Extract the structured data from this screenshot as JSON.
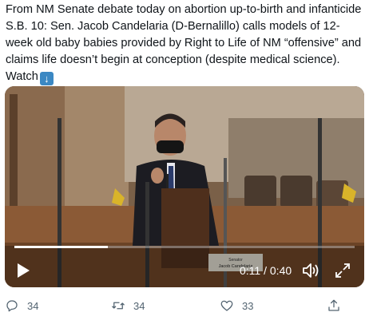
{
  "tweet": {
    "text": "From NM Senate debate today on abortion up-to-birth and infanticide S.B. 10: Sen. Jacob Candelaria (D-Bernalillo) calls models of 12-week old baby babies provided by Right to Life of NM “offensive” and claims life doesn’t begin at conception (despite medical science). Watch",
    "emoji": "arrow-down-emoji"
  },
  "video": {
    "current_time": "0:11",
    "separator": " / ",
    "duration": "0:40",
    "progress_fraction": 0.275,
    "nameplate_line1": "Senator",
    "nameplate_line2": "Jacob Candelaria",
    "play_icon": "play-icon",
    "volume_icon": "volume-icon",
    "fullscreen_icon": "fullscreen-icon"
  },
  "actions": {
    "reply_count": "34",
    "retweet_count": "34",
    "like_count": "33"
  },
  "colors": {
    "text": "#0f1419",
    "muted": "#536471",
    "emoji_blue": "#3b88c3"
  }
}
